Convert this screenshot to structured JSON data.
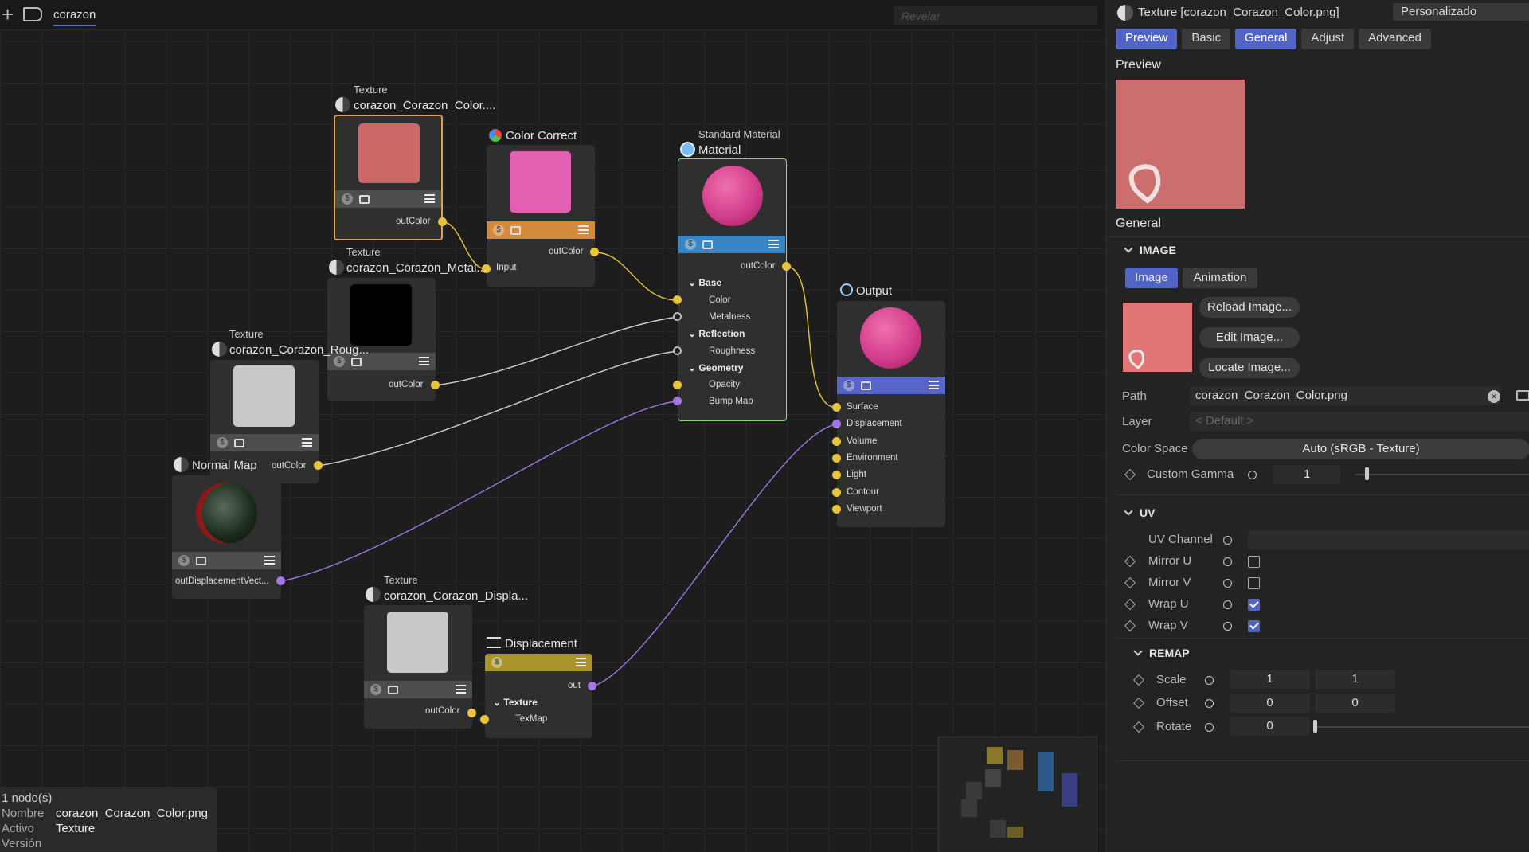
{
  "topbar": {
    "tab": "corazon",
    "search_placeholder": "Revelar"
  },
  "nodes": {
    "tex_color": {
      "type": "Texture",
      "name": "corazon_Corazon_Color....",
      "out": "outColor"
    },
    "color_correct": {
      "name": "Color Correct",
      "in": "Input",
      "out": "outColor"
    },
    "tex_metal": {
      "type": "Texture",
      "name": "corazon_Corazon_Metal...",
      "out": "outColor"
    },
    "tex_rough": {
      "type": "Texture",
      "name": "corazon_Corazon_Roug...",
      "out": "outColor"
    },
    "normal_map": {
      "name": "Normal Map",
      "out": "outDisplacementVect..."
    },
    "material": {
      "type": "Standard Material",
      "name": "Material",
      "out": "outColor",
      "sections": [
        "Base",
        "Reflection",
        "Geometry"
      ],
      "ports": [
        "Color",
        "Metalness",
        "Roughness",
        "Opacity",
        "Bump Map"
      ]
    },
    "output": {
      "name": "Output",
      "ports": [
        "Surface",
        "Displacement",
        "Volume",
        "Environment",
        "Light",
        "Contour",
        "Viewport"
      ]
    },
    "tex_displ": {
      "type": "Texture",
      "name": "corazon_Corazon_Displa...",
      "out": "outColor"
    },
    "displacement": {
      "name": "Displacement",
      "out": "out",
      "section": "Texture",
      "port": "TexMap"
    }
  },
  "status": {
    "count": "1 nodo(s)",
    "rows": [
      {
        "k": "Nombre",
        "v": "corazon_Corazon_Color.png"
      },
      {
        "k": "Activo",
        "v": "Texture"
      },
      {
        "k": "Versión",
        "v": ""
      }
    ]
  },
  "panel": {
    "title": "Texture [corazon_Corazon_Color.png]",
    "layout_select": "Personalizado",
    "tabs": [
      "Preview",
      "Basic",
      "General",
      "Adjust",
      "Advanced"
    ],
    "preview_label": "Preview",
    "general_label": "General",
    "image_section": "IMAGE",
    "image_tabs": [
      "Image",
      "Animation"
    ],
    "buttons": {
      "reload": "Reload Image...",
      "edit": "Edit Image...",
      "locate": "Locate Image..."
    },
    "path_label": "Path",
    "path_value": "corazon_Corazon_Color.png",
    "layer_label": "Layer",
    "layer_value": "< Default >",
    "colorspace_label": "Color Space",
    "colorspace_value": "Auto (sRGB - Texture)",
    "gamma_label": "Custom Gamma",
    "gamma_value": "1",
    "uv_section": "UV",
    "uv_channel_label": "UV Channel",
    "mirror_u": "Mirror U",
    "mirror_v": "Mirror V",
    "wrap_u": "Wrap U",
    "wrap_v": "Wrap V",
    "remap_section": "REMAP",
    "scale_label": "Scale",
    "scale_values": [
      "1",
      "1"
    ],
    "offset_label": "Offset",
    "offset_values": [
      "0",
      "0"
    ],
    "rotate_label": "Rotate",
    "rotate_value": "0"
  },
  "colors": {
    "accent": "#5265c6",
    "port_yellow": "#e8c43a",
    "port_violet": "#a276e6",
    "texture_pink": "#cc6e6e"
  }
}
